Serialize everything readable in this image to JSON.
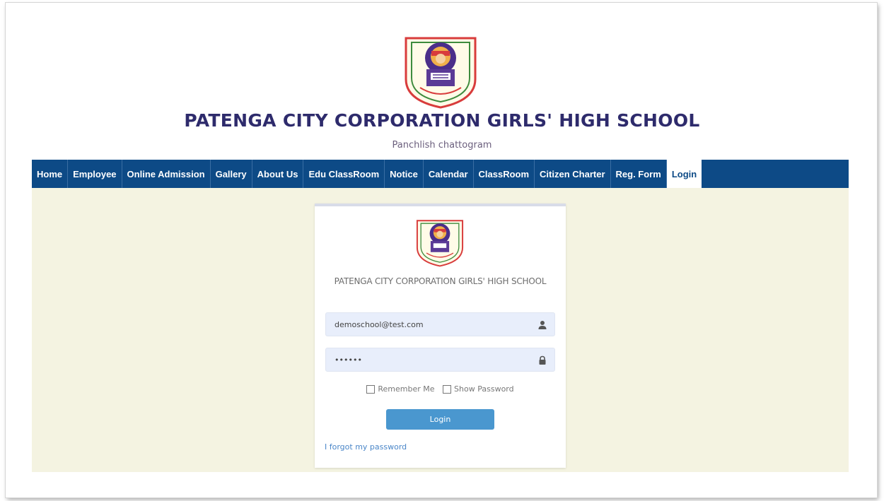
{
  "header": {
    "school_name": "PATENGA CITY CORPORATION GIRLS' HIGH SCHOOL",
    "subtitle": "Panchlish chattogram"
  },
  "nav": {
    "items": [
      {
        "label": "Home"
      },
      {
        "label": "Employee"
      },
      {
        "label": "Online Admission"
      },
      {
        "label": "Gallery"
      },
      {
        "label": "About Us"
      },
      {
        "label": "Edu ClassRoom"
      },
      {
        "label": "Notice"
      },
      {
        "label": "Calendar"
      },
      {
        "label": "ClassRoom"
      },
      {
        "label": "Citizen Charter"
      },
      {
        "label": "Reg. Form"
      },
      {
        "label": "Login",
        "active": true
      }
    ]
  },
  "login_card": {
    "title": "PATENGA CITY CORPORATION GIRLS' HIGH SCHOOL",
    "email_value": "demoschool@test.com",
    "password_value": "••••••",
    "remember_label": "Remember Me",
    "show_password_label": "Show Password",
    "login_button": "Login",
    "forgot_link": "I forgot my password"
  },
  "colors": {
    "nav_bg": "#0d4a86",
    "title_color": "#2e2b6c",
    "content_bg": "#f4f3e1",
    "button_bg": "#4a97cf"
  },
  "icons": {
    "school_logo": "school-crest",
    "email_field": "user-icon",
    "password_field": "lock-icon"
  }
}
